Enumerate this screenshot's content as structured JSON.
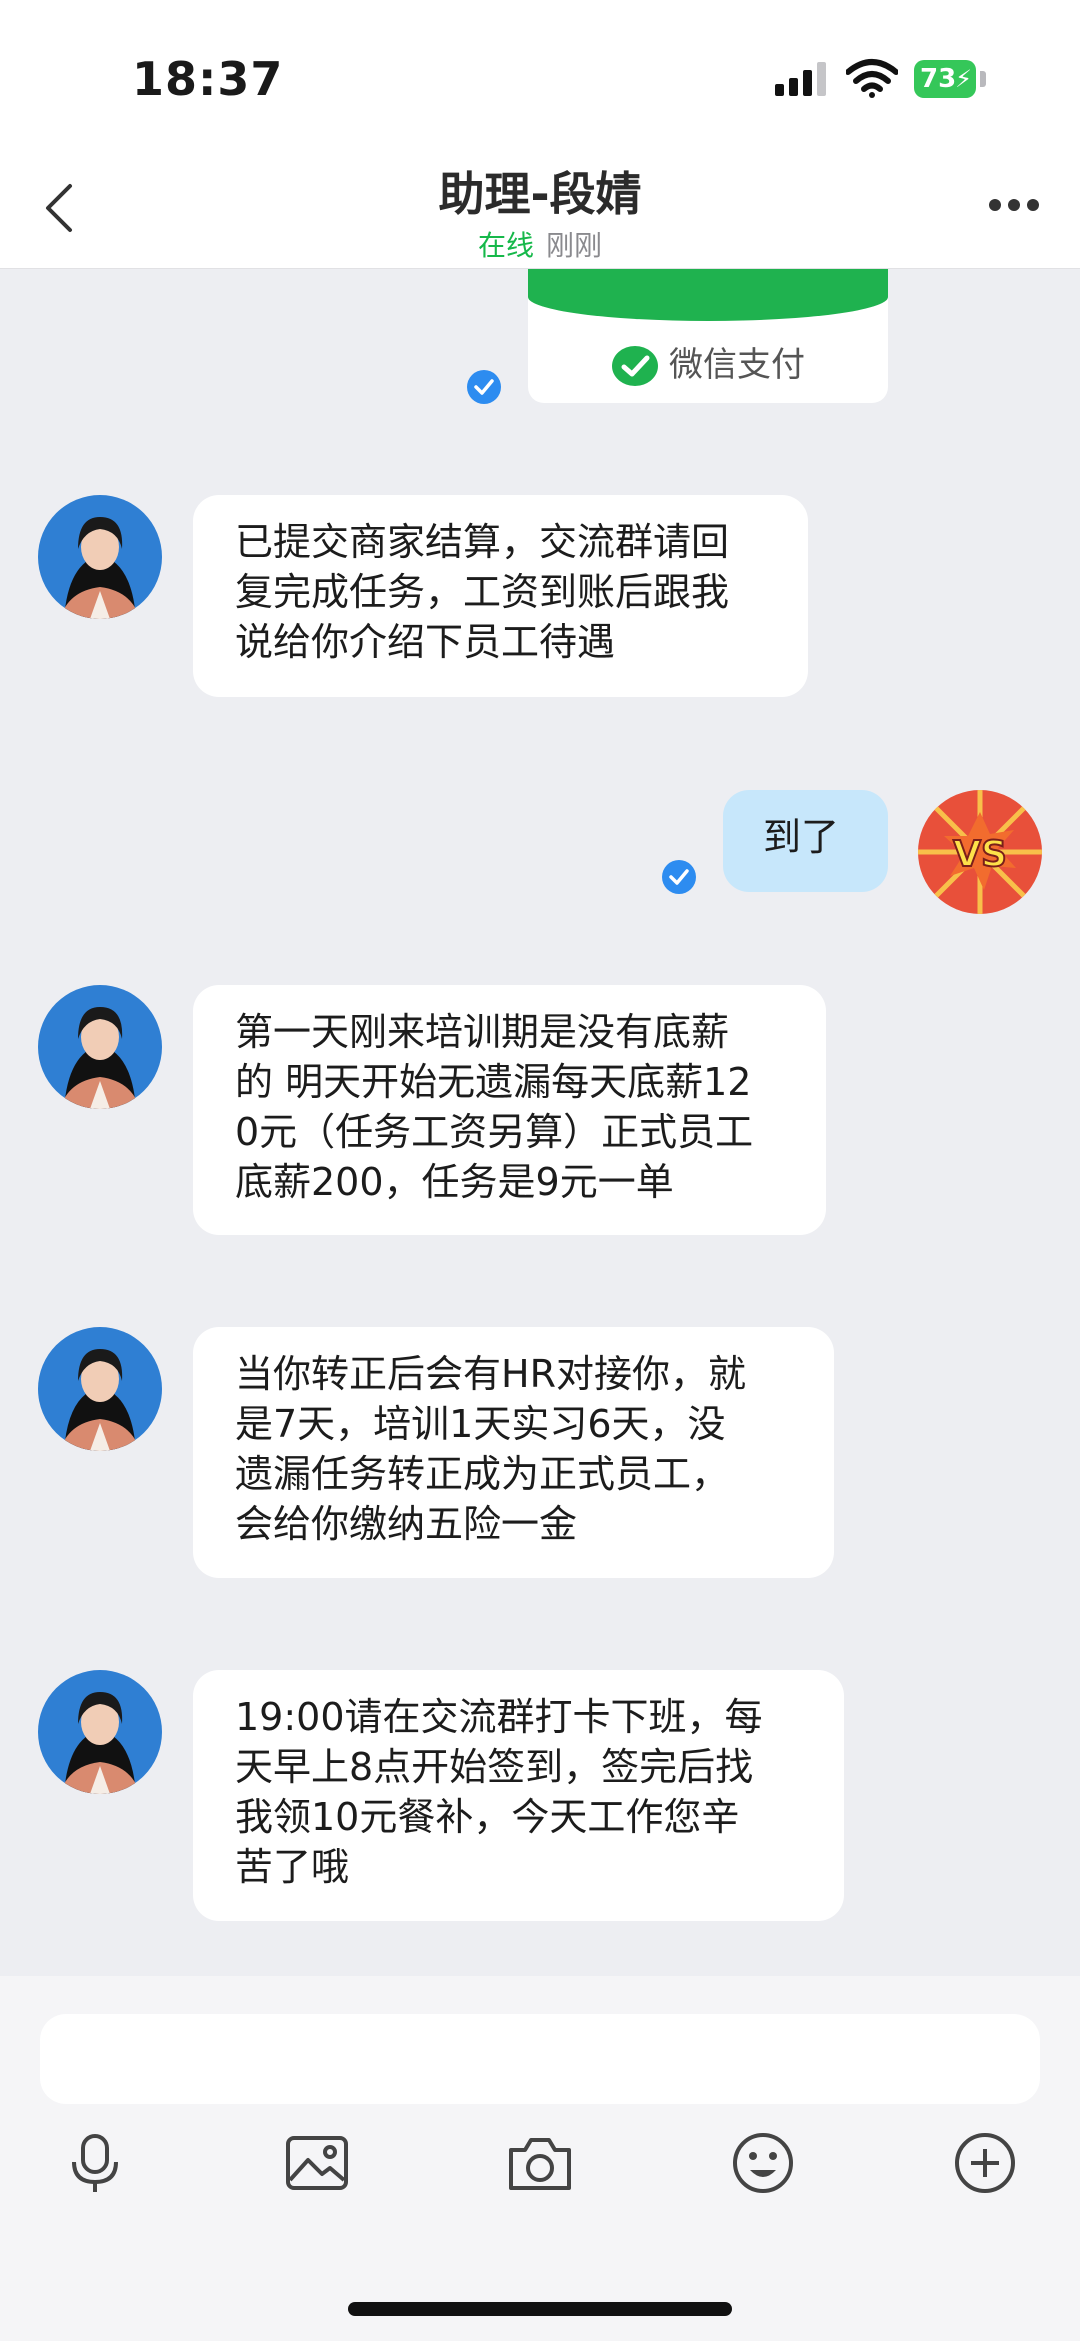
{
  "status": {
    "time": "18:37",
    "battery": "73"
  },
  "header": {
    "title": "助理-段婧",
    "online": "在线",
    "last_seen": "刚刚"
  },
  "pay_card": {
    "label": "微信支付"
  },
  "messages": [
    {
      "side": "left",
      "text": "已提交商家结算，交流群请回\n复完成任务，工资到账后跟我\n说给你介绍下员工待遇"
    },
    {
      "side": "right",
      "text": "到了"
    },
    {
      "side": "left",
      "text": "第一天刚来培训期是没有底薪\n的 明天开始无遗漏每天底薪12\n0元（任务工资另算）正式员工\n底薪200，任务是9元一单"
    },
    {
      "side": "left",
      "text": "当你转正后会有HR对接你，就\n是7天，培训1天实习6天，没\n遗漏任务转正成为正式员工，\n会给你缴纳五险一金"
    },
    {
      "side": "left",
      "text": "19:00请在交流群打卡下班，每\n天早上8点开始签到，签完后找\n我领10元餐补，今天工作您辛\n苦了哦"
    }
  ],
  "icons": [
    "back-icon",
    "more-icon",
    "check-icon",
    "mic-icon",
    "image-icon",
    "camera-icon",
    "emoji-icon",
    "plus-icon"
  ],
  "colors": {
    "online": "#16b84a",
    "my_bubble": "#c7e7fb",
    "check": "#2d8cf0",
    "wechat_green": "#1fb24f"
  }
}
